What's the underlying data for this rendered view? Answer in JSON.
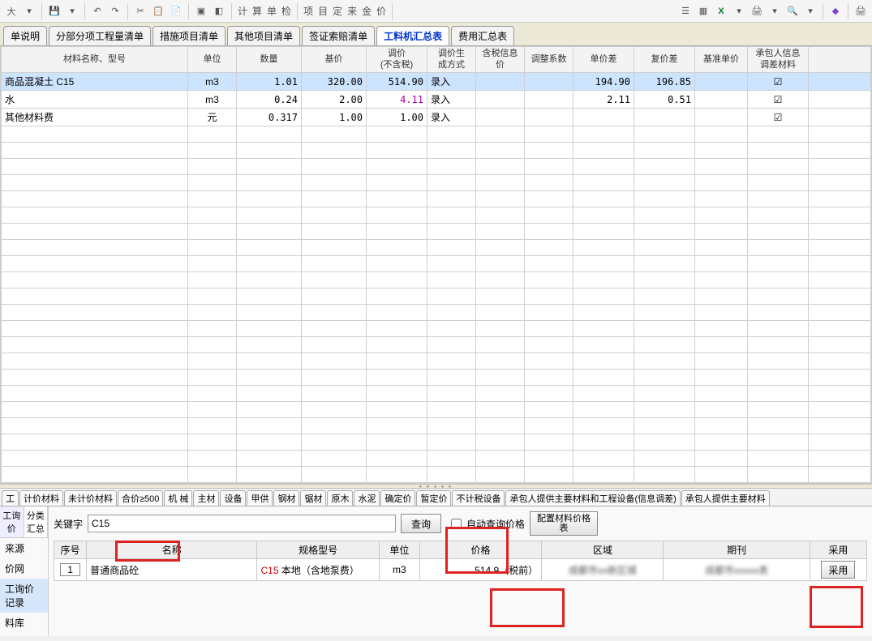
{
  "toolbar": {
    "items": [
      "大",
      "▾",
      "",
      "💾",
      "▾",
      "",
      "↶",
      "↷",
      "",
      "✂",
      "📋",
      "📄",
      "",
      "",
      ""
    ],
    "calc_buttons": [
      "计",
      "算",
      "单",
      "检",
      "",
      "项",
      "目",
      "定",
      "来",
      "金",
      "价"
    ],
    "right_icons": [
      "📋",
      "🖥",
      "X",
      "▾",
      "🖨",
      "▾",
      "🔍",
      "▾",
      "",
      "📘",
      "",
      "🖨"
    ]
  },
  "main_tabs": [
    "单说明",
    "分部分项工程量清单",
    "措施项目清单",
    "其他项目清单",
    "签证索赔清单",
    "工料机汇总表",
    "费用汇总表"
  ],
  "main_tabs_active": 5,
  "grid": {
    "headers": [
      "材料名称、型号",
      "单位",
      "数量",
      "基价",
      "调价\n(不含税)",
      "调价生\n成方式",
      "含税信息\n价",
      "调整系数",
      "单价差",
      "复价差",
      "基准单价",
      "承包人信息\n调差材料"
    ],
    "rows": [
      {
        "name": "商品混凝土 C15",
        "unit": "m3",
        "qty": "1.01",
        "base": "320.00",
        "adj": "514.90",
        "mode": "录入",
        "tax": "",
        "coef": "",
        "udiff": "194.90",
        "cdiff": "196.85",
        "bench": "",
        "chk": true,
        "selected": true
      },
      {
        "name": "水",
        "unit": "m3",
        "qty": "0.24",
        "base": "2.00",
        "adj": "4.11",
        "mode": "录入",
        "tax": "",
        "coef": "",
        "udiff": "2.11",
        "cdiff": "0.51",
        "bench": "",
        "chk": true,
        "selected": false,
        "adj_color": "#aa00aa"
      },
      {
        "name": "其他材料费",
        "unit": "元",
        "qty": "0.317",
        "base": "1.00",
        "adj": "1.00",
        "mode": "录入",
        "tax": "",
        "coef": "",
        "udiff": "",
        "cdiff": "",
        "bench": "",
        "chk": true,
        "selected": false
      }
    ]
  },
  "lower_tabs": [
    "工",
    "计价材料",
    "未计价材料",
    "合价≥500",
    "机 械",
    "主材",
    "设备",
    "甲供",
    "钢材",
    "锯材",
    "原木",
    "水泥",
    "确定价",
    "暂定价",
    "不计税设备",
    "承包人提供主要材料和工程设备(信息调差)",
    "承包人提供主要材料"
  ],
  "side_tabs": [
    "工询价",
    "分类汇总"
  ],
  "side_items": [
    "来源",
    "价网",
    "工询价记录",
    "料库"
  ],
  "search": {
    "label": "关键字",
    "value": "C15",
    "btn": "查询",
    "auto_chk_label": "自动查询价格",
    "config_btn": "配置材料价格\n表"
  },
  "result": {
    "headers": [
      "序号",
      "名称",
      "规格型号",
      "单位",
      "价格",
      "区域",
      "期刊",
      "采用"
    ],
    "row": {
      "no": "1",
      "name": "普通商品砼",
      "spec_prefix": "C15",
      "spec_suffix": " 本地（含地泵费）",
      "unit": "m3",
      "price": "514.9（税前）",
      "area": "成都市xx新区城",
      "period": "成都市xxxxx表",
      "use_btn": "采用"
    }
  }
}
